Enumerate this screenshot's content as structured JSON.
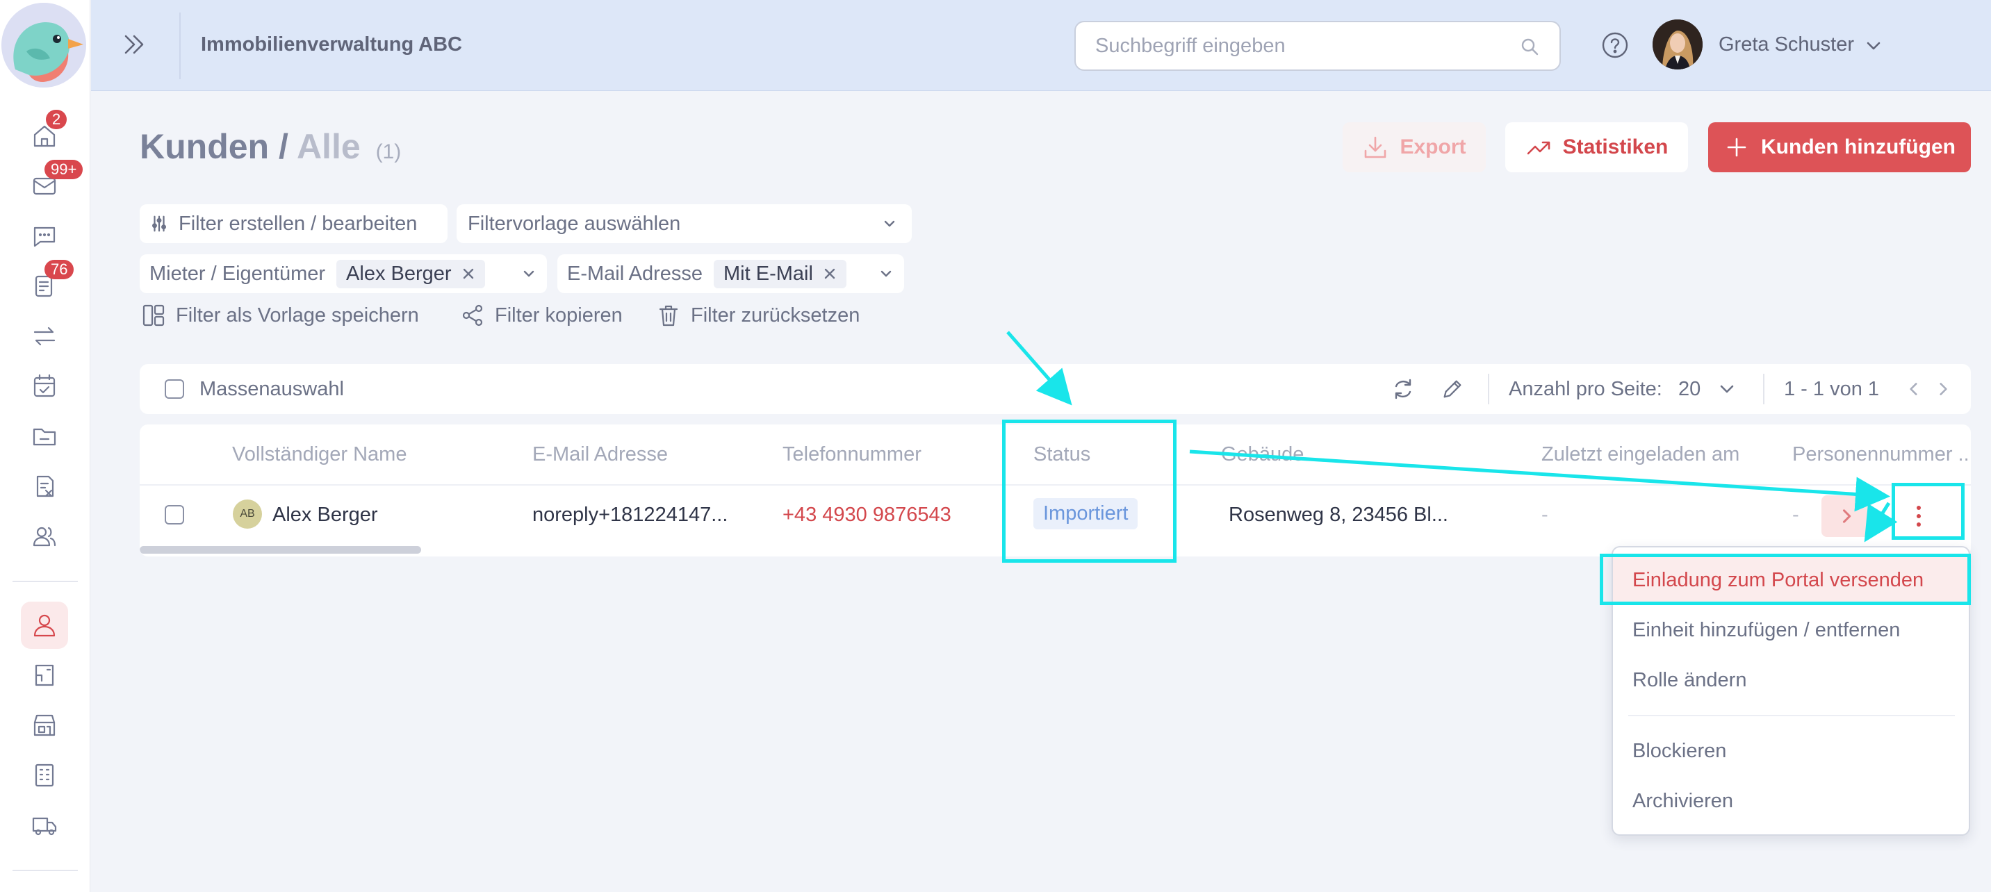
{
  "nav": {
    "badges": {
      "home": "2",
      "mail": "99+",
      "tasks": "76"
    },
    "icons": [
      "home-icon",
      "mail-icon",
      "chat-icon",
      "tasks-icon",
      "transfer-icon",
      "calendar-icon",
      "folder-icon",
      "report-icon",
      "people-icon",
      "person-icon",
      "document-icon",
      "shop-icon",
      "building-icon",
      "truck-icon"
    ]
  },
  "header": {
    "title": "Immobilienverwaltung ABC",
    "search_placeholder": "Suchbegriff eingeben",
    "user_name": "Greta Schuster"
  },
  "page": {
    "title": "Kunden",
    "separator": "/",
    "subtitle": "Alle",
    "count": "(1)"
  },
  "actions": {
    "export": "Export",
    "statistics": "Statistiken",
    "add_customer": "Kunden hinzufügen"
  },
  "filters": {
    "edit": "Filter erstellen / bearbeiten",
    "template_select": "Filtervorlage auswählen",
    "chip1_label": "Mieter / Eigentümer",
    "chip1_value": "Alex Berger",
    "chip2_label": "E-Mail Adresse",
    "chip2_value": "Mit E-Mail",
    "save_template": "Filter als Vorlage speichern",
    "copy": "Filter kopieren",
    "reset": "Filter zurücksetzen"
  },
  "toolbar": {
    "bulk_select": "Massenauswahl",
    "per_page_label": "Anzahl pro Seite:",
    "per_page_value": "20",
    "pagination": "1 - 1 von 1"
  },
  "table": {
    "columns": [
      "Vollständiger Name",
      "E-Mail Adresse",
      "Telefonnummer",
      "Status",
      "Gebäude",
      "Zuletzt eingeladen am",
      "Personennummer ..."
    ],
    "rows": [
      {
        "initials": "AB",
        "name": "Alex Berger",
        "email": "noreply+181224147...",
        "phone": "+43 4930 9876543",
        "status": "Importiert",
        "building": "Rosenweg 8, 23456 Bl...",
        "last_invited": "-",
        "person_number": "-"
      }
    ]
  },
  "menu": {
    "items": [
      "Einladung zum Portal versenden",
      "Einheit hinzufügen / entfernen",
      "Rolle ändern",
      "Blockieren",
      "Archivieren"
    ]
  },
  "colors": {
    "accent": "#dd5357",
    "annotation": "#19e5ea",
    "status_text": "#6a96dc"
  }
}
